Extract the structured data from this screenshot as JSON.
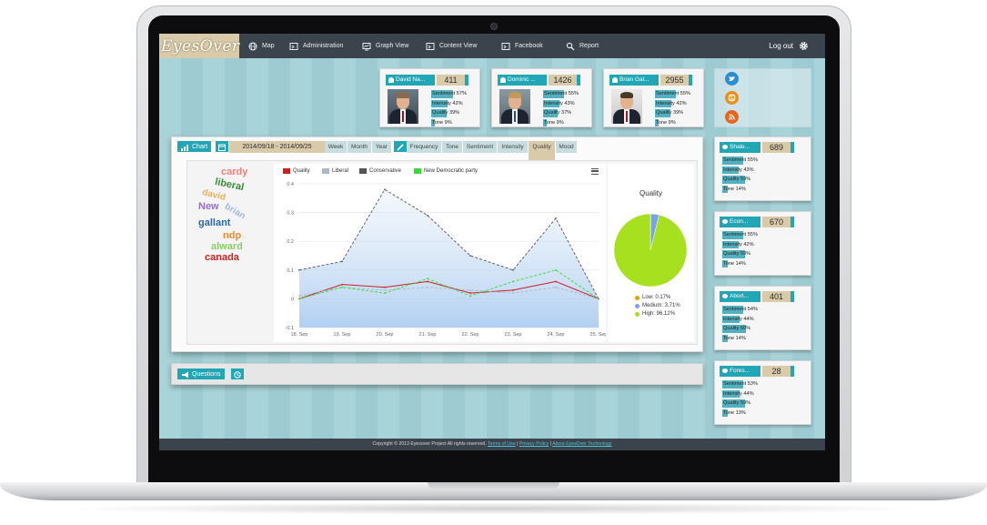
{
  "app": {
    "logo": "EyesOver",
    "nav": [
      {
        "label": "Map",
        "icon": "globe-icon"
      },
      {
        "label": "Administration",
        "icon": "admin-icon"
      },
      {
        "label": "Graph View",
        "icon": "graph-icon"
      },
      {
        "label": "Content View",
        "icon": "content-icon"
      },
      {
        "label": "Facebook",
        "icon": "facebook-icon"
      },
      {
        "label": "Report",
        "icon": "search-icon"
      }
    ],
    "logout": "Log out"
  },
  "profiles": [
    {
      "name": "David Na...",
      "score": "411",
      "metrics": {
        "sentiment": "Sentiment 57%",
        "intensity": "Intensity 42%",
        "quality": "Quality 39%",
        "tone": "Tone 9%"
      },
      "values": {
        "sentiment": 57,
        "intensity": 42,
        "quality": 39,
        "tone": 9
      }
    },
    {
      "name": "Dominic ...",
      "score": "1426",
      "metrics": {
        "sentiment": "Sentiment 55%",
        "intensity": "Intensity 43%",
        "quality": "Quality 37%",
        "tone": "Tone 9%"
      },
      "values": {
        "sentiment": 55,
        "intensity": 43,
        "quality": 37,
        "tone": 9
      }
    },
    {
      "name": "Brian Gal...",
      "score": "2955",
      "metrics": {
        "sentiment": "Sentiment 55%",
        "intensity": "Intensity 42%",
        "quality": "Quality 39%",
        "tone": "Tone 9%"
      },
      "values": {
        "sentiment": 55,
        "intensity": 42,
        "quality": 39,
        "tone": 9
      }
    }
  ],
  "social": [
    "twitter-icon",
    "blogger-icon",
    "rss-icon"
  ],
  "chart_panel": {
    "chart_tab": "Chart",
    "date_range": "2014/09/18 - 2014/09/25",
    "periods": [
      "Week",
      "Month",
      "Year"
    ],
    "measures": [
      "Frequency",
      "Tone",
      "Sentiment",
      "Intensity",
      "Quality",
      "Mood"
    ],
    "active_measure": "Quality",
    "questions_tab": "Questions"
  },
  "wordcloud": [
    {
      "text": "cardy",
      "color": "#f08080"
    },
    {
      "text": "liberal",
      "color": "#3a8a3a"
    },
    {
      "text": "david",
      "color": "#e8b060"
    },
    {
      "text": "brian",
      "color": "#9fb8e0"
    },
    {
      "text": "New",
      "color": "#9a6ad0"
    },
    {
      "text": "gallant",
      "color": "#2a6aaa"
    },
    {
      "text": "ndp",
      "color": "#f08a30"
    },
    {
      "text": "alward",
      "color": "#8ad060"
    },
    {
      "text": "canada",
      "color": "#cc2222"
    }
  ],
  "chart_data": [
    {
      "type": "line",
      "x": [
        "18. Sep",
        "19. Sep",
        "20. Sep",
        "21. Sep",
        "22. Sep",
        "23. Sep",
        "24. Sep",
        "25. Sep"
      ],
      "ylim": [
        -0.1,
        0.4
      ],
      "yticks": [
        "0.4",
        "0.3",
        "0.2",
        "0.1",
        "0",
        "-0.1"
      ],
      "series": [
        {
          "name": "Quality",
          "color": "#cc1f1f",
          "values": [
            0.0,
            0.05,
            0.04,
            0.06,
            0.02,
            0.03,
            0.06,
            0.0
          ]
        },
        {
          "name": "Liberal",
          "color": "#b0b6c2",
          "values": [
            0.01,
            0.04,
            0.03,
            0.04,
            0.03,
            0.02,
            0.04,
            0.0
          ]
        },
        {
          "name": "Conservative",
          "color": "#555555",
          "values": [
            0.1,
            0.13,
            0.38,
            0.29,
            0.15,
            0.1,
            0.28,
            0.0
          ]
        },
        {
          "name": "New Democratic party",
          "color": "#33dd33",
          "values": [
            0.0,
            0.04,
            0.02,
            0.07,
            0.01,
            0.06,
            0.1,
            0.0
          ]
        }
      ]
    },
    {
      "type": "pie",
      "title": "Quality",
      "labels": [
        "Low: 0.17%",
        "Medium: 3.71%",
        "High: 96.12%"
      ],
      "values": [
        0.17,
        3.71,
        96.12
      ],
      "colors": [
        "#e8a000",
        "#7aa2ea",
        "#a6e01e"
      ]
    }
  ],
  "topics": [
    {
      "name": "Shale...",
      "score": "689",
      "metrics": {
        "sentiment": "Sentiment 55%",
        "intensity": "Intensity 43%",
        "quality": "Quality 59%",
        "tone": "Tone 14%"
      },
      "values": {
        "sentiment": 55,
        "intensity": 43,
        "quality": 59,
        "tone": 14
      }
    },
    {
      "name": "Econ...",
      "score": "670",
      "metrics": {
        "sentiment": "Sentiment 55%",
        "intensity": "Intensity 42%",
        "quality": "Quality 59%",
        "tone": "Tone 14%"
      },
      "values": {
        "sentiment": 55,
        "intensity": 42,
        "quality": 59,
        "tone": 14
      }
    },
    {
      "name": "Abort...",
      "score": "401",
      "metrics": {
        "sentiment": "Sentiment 54%",
        "intensity": "Intensity 44%",
        "quality": "Quality 60%",
        "tone": "Tone 14%"
      },
      "values": {
        "sentiment": 54,
        "intensity": 44,
        "quality": 60,
        "tone": 14
      }
    },
    {
      "name": "Fores...",
      "score": "28",
      "metrics": {
        "sentiment": "Sentiment 53%",
        "intensity": "Intensity 44%",
        "quality": "Quality 59%",
        "tone": "Tone 13%"
      },
      "values": {
        "sentiment": 53,
        "intensity": 44,
        "quality": 59,
        "tone": 13
      }
    }
  ],
  "footer": {
    "copyright": "Copyright © 2013 Eyesover Project All rights reserved.",
    "links": [
      "Terms of Use",
      "Privacy Policy",
      "About EyesOver Technology"
    ],
    "separator": "|"
  }
}
